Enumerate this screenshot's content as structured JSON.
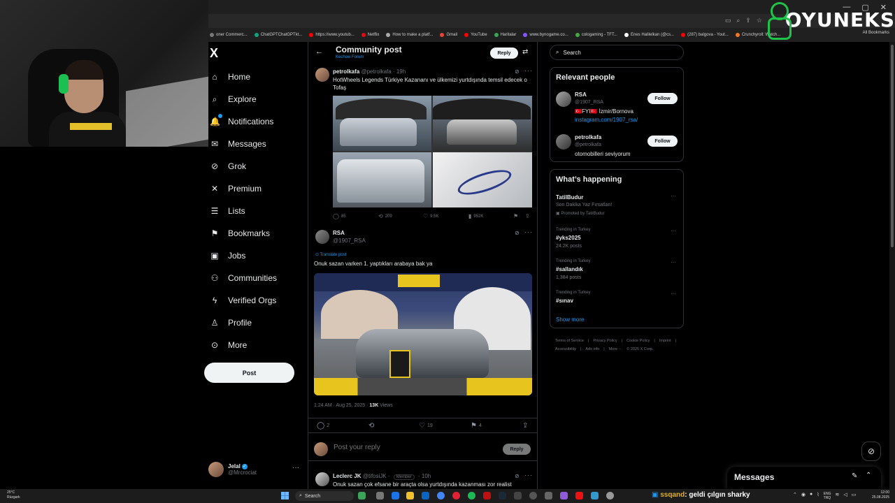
{
  "bookmarks": [
    {
      "label": "oner Commerc...",
      "color": "#777777"
    },
    {
      "label": "ChatGPTChatGPTkt...",
      "color": "#10a37f"
    },
    {
      "label": "https://www.youtub...",
      "color": "#ff0000"
    },
    {
      "label": "Netflix",
      "color": "#e50914"
    },
    {
      "label": "How to make a platf...",
      "color": "#aaaaaa"
    },
    {
      "label": "Gmail",
      "color": "#ea4335"
    },
    {
      "label": "YouTube",
      "color": "#ff0000"
    },
    {
      "label": "Haritalar",
      "color": "#34a853"
    },
    {
      "label": "www.bynogame.co...",
      "color": "#8855ff"
    },
    {
      "label": "cologaming - TFT...",
      "color": "#44aa44"
    },
    {
      "label": "Enes Halilelkan (@cs...",
      "color": "#ffffff"
    },
    {
      "label": "(287) balgova - Yout...",
      "color": "#ff0000"
    },
    {
      "label": "Crunchyroll: Watch...",
      "color": "#f47521"
    }
  ],
  "browser": {
    "all_bookmarks": "All Bookmarks"
  },
  "brand": {
    "word": "OYUNEKS",
    "accent": "#1ec34a"
  },
  "sidebar": {
    "logo": "X",
    "items": [
      {
        "label": "Home",
        "icon": "home-icon",
        "glyph": "⌂"
      },
      {
        "label": "Explore",
        "icon": "search-icon",
        "glyph": "⌕"
      },
      {
        "label": "Notifications",
        "icon": "bell-icon",
        "glyph": "🔔"
      },
      {
        "label": "Messages",
        "icon": "mail-icon",
        "glyph": "✉"
      },
      {
        "label": "Grok",
        "icon": "grok-icon",
        "glyph": "⊘"
      },
      {
        "label": "Premium",
        "icon": "x-premium-icon",
        "glyph": "✕"
      },
      {
        "label": "Lists",
        "icon": "list-icon",
        "glyph": "☰"
      },
      {
        "label": "Bookmarks",
        "icon": "bookmark-icon",
        "glyph": "⚑"
      },
      {
        "label": "Jobs",
        "icon": "briefcase-icon",
        "glyph": "▣"
      },
      {
        "label": "Communities",
        "icon": "people-icon",
        "glyph": "⚇"
      },
      {
        "label": "Verified Orgs",
        "icon": "lightning-icon",
        "glyph": "ϟ"
      },
      {
        "label": "Profile",
        "icon": "person-icon",
        "glyph": "♙"
      },
      {
        "label": "More",
        "icon": "more-circle-icon",
        "glyph": "⊙"
      }
    ],
    "post_label": "Post",
    "profile": {
      "name": "Jelal",
      "handle": "@Mrcrociat"
    }
  },
  "main": {
    "title": "Community post",
    "subtitle": "Kechow Forum",
    "reply_label": "Reply",
    "quoted_post": {
      "author": "petrolkafa",
      "meta": "@petrolkafa · 19h",
      "text": "HotWheels Legends Türkiye Kazananı ve ülkemizi yurtdışında temsil edecek o Tofaş",
      "replies": "85",
      "reposts": "209",
      "likes": "9.5K",
      "views": "952K"
    },
    "focused_post": {
      "author": "RSA",
      "handle": "@1907_RSA",
      "translate": "Translate post",
      "text": "Onuk sazan varken 1. yaptıkları arabaya bak ya",
      "timestamp": "1:24 AM · Aug 25, 2025 ·",
      "views_count": "13K",
      "views_label": "Views",
      "replies": "2",
      "reposts": "",
      "likes": "19",
      "bookmarks": "4"
    },
    "reply_placeholder": "Post your reply",
    "reply_button": "Reply",
    "next_reply": {
      "author": "Leclerc JK",
      "handle": "@tifosiJK ·",
      "badge": "Member",
      "time": "· 10h",
      "text": "Onuk sazan çok efsane bir araçta olsa yurtdışında kazanması zor realist"
    }
  },
  "right": {
    "search_placeholder": "Search",
    "relevant_title": "Relevant people",
    "people": [
      {
        "name": "RSA",
        "handle": "@1907_RSA",
        "bio": "🇹🇷FYI🇹🇷 İzmir/Bornova",
        "link": "instagram.com/1907_rsa/",
        "follow": "Follow"
      },
      {
        "name": "petrolkafa",
        "handle": "@petrolkafa",
        "bio": "otomobilleri seviyorum",
        "link": "",
        "follow": "Follow"
      }
    ],
    "happening_title": "What’s happening",
    "trends": [
      {
        "meta": "",
        "title": "TatilBudur",
        "sub": "Son Dakika Yaz Fırsatları!",
        "sub2": "Promoted by TatilBudur"
      },
      {
        "meta": "Trending in Turkey",
        "title": "#yks2025",
        "sub": "24.2K posts",
        "sub2": ""
      },
      {
        "meta": "Trending in Turkey",
        "title": "#sallandık",
        "sub": "1,384 posts",
        "sub2": ""
      },
      {
        "meta": "Trending in Turkey",
        "title": "#sınav",
        "sub": "",
        "sub2": ""
      }
    ],
    "show_more": "Show more",
    "footer": [
      "Terms of Service",
      "|",
      "Privacy Policy",
      "|",
      "Cookie Policy",
      "|",
      "Imprint",
      "|",
      "Accessibility",
      "|",
      "Ads info",
      "|",
      "More ···",
      "© 2025 X Corp."
    ]
  },
  "messages_drawer": {
    "title": "Messages"
  },
  "taskbar": {
    "weather_temp": "25°C",
    "weather_desc": "Rüzgarlı",
    "search_label": "Search",
    "chat_user": "ssqand",
    "chat_text": ": geldi çılgın sharky",
    "lang1": "ENG",
    "lang2": "TRQ",
    "time": "12:00",
    "date": "25.08.2025"
  }
}
